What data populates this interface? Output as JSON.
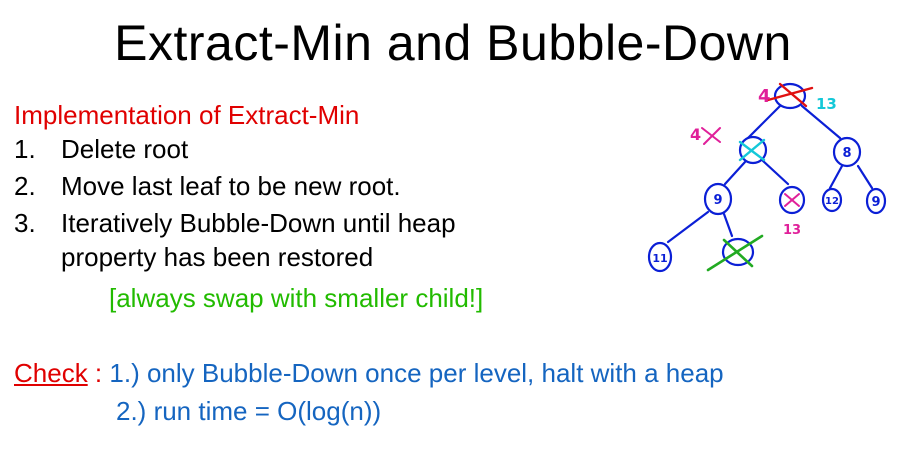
{
  "slide": {
    "title": "Extract-Min and Bubble-Down",
    "heading": "Implementation of Extract-Min",
    "steps": [
      {
        "num": "1.",
        "text": "Delete root"
      },
      {
        "num": "2.",
        "text": "Move last leaf to be new root."
      },
      {
        "num": "3.",
        "text": "Iteratively Bubble-Down until heap"
      }
    ],
    "step3_continued": "property has been restored",
    "note": "[always swap with smaller child!]",
    "check": {
      "label": "Check",
      "colon": " :",
      "item1": " 1.)  only Bubble-Down once per level, halt with a heap",
      "item2": "2.)  run time = O(log(n))"
    }
  },
  "diagram": {
    "colors": {
      "tree": "#0b1fd6",
      "red": "#e01010",
      "cyan": "#14c8d8",
      "magenta": "#e0209a",
      "green": "#22aa22"
    },
    "nodes": {
      "root_handwritten": "4",
      "root_new": "13",
      "left_handwritten": "4",
      "right": "8",
      "left_left": "9",
      "left_right_new": "13",
      "right_left": "12",
      "right_right": "9",
      "bottom_left": "11"
    }
  }
}
